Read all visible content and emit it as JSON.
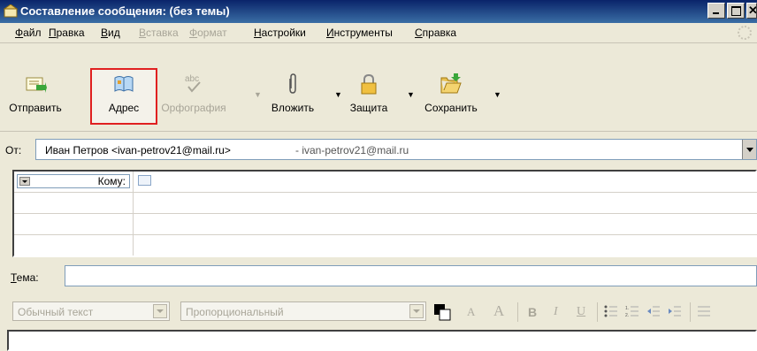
{
  "window": {
    "title": "Составление сообщения: (без темы)"
  },
  "menu": [
    {
      "label": "Файл",
      "disabled": false
    },
    {
      "label": "Правка",
      "disabled": false
    },
    {
      "label": "Вид",
      "disabled": false
    },
    {
      "label": "Вставка",
      "disabled": true
    },
    {
      "label": "Формат",
      "disabled": true
    },
    {
      "label": "Настройки",
      "disabled": false
    },
    {
      "label": "Инструменты",
      "disabled": false
    },
    {
      "label": "Справка",
      "disabled": false
    }
  ],
  "toolbar": {
    "send": "Отправить",
    "address": "Адрес",
    "spelling": "Орфография",
    "attach": "Вложить",
    "security": "Защита",
    "save": "Сохранить"
  },
  "from": {
    "label": "От:",
    "name": "Иван Петров <ivan-petrov21@mail.ru>",
    "account": "- ivan-petrov21@mail.ru"
  },
  "recipients": {
    "type": "Кому:"
  },
  "subject": {
    "label": "Тема:",
    "value": ""
  },
  "format": {
    "paragraph": "Обычный текст",
    "font": "Пропорциональный",
    "bold": "B",
    "italic": "I",
    "underline": "U",
    "smaller": "A",
    "larger": "A"
  },
  "colors": {
    "title_start": "#0a246a",
    "title_end": "#3a6ea5",
    "highlight": "#e02020"
  }
}
